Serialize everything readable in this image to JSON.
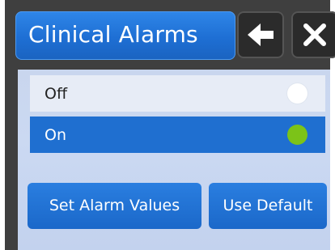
{
  "header": {
    "title": "Clinical Alarms",
    "back_icon": "arrow-left-icon",
    "close_icon": "close-icon"
  },
  "options": [
    {
      "label": "Off",
      "selected": false,
      "indicator_color": "#ffffff"
    },
    {
      "label": "On",
      "selected": true,
      "indicator_color": "#7cc318"
    }
  ],
  "actions": {
    "set_alarm_values": "Set Alarm Values",
    "use_default": "Use Default"
  },
  "colors": {
    "accent": "#1f6fd0",
    "background": "#3f3f3f",
    "panel": "#c9d6ee"
  }
}
